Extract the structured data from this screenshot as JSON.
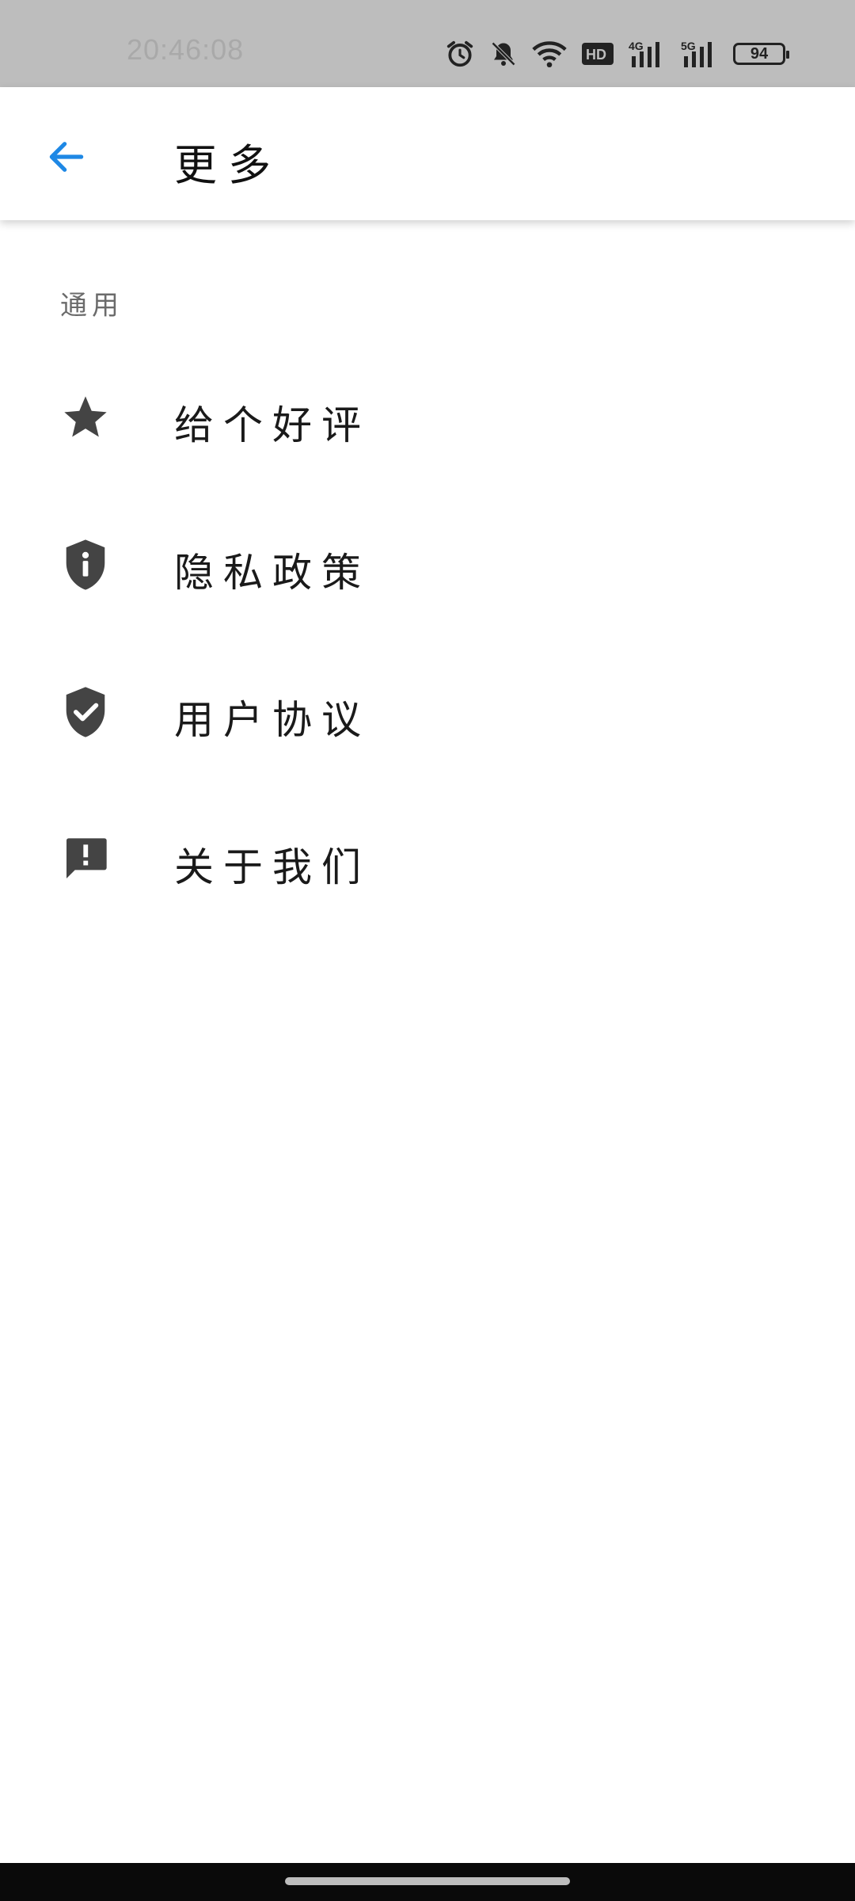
{
  "status_bar": {
    "time": "20:46:08",
    "battery": "94",
    "icons": [
      "alarm-icon",
      "bell-off-icon",
      "wifi-icon",
      "hd-icon",
      "signal-4g-icon",
      "signal-5g-icon",
      "battery-icon"
    ],
    "network_labels": {
      "hd": "HD",
      "lte": "4G",
      "nr": "5G"
    }
  },
  "app_bar": {
    "title": "更多",
    "back_icon": "arrow-left-icon",
    "accent_color": "#1e88e5"
  },
  "section": {
    "header": "通用",
    "items": [
      {
        "label": "给个好评",
        "icon": "star-icon"
      },
      {
        "label": "隐私政策",
        "icon": "shield-info-icon"
      },
      {
        "label": "用户协议",
        "icon": "shield-check-icon"
      },
      {
        "label": "关于我们",
        "icon": "feedback-icon"
      }
    ]
  }
}
